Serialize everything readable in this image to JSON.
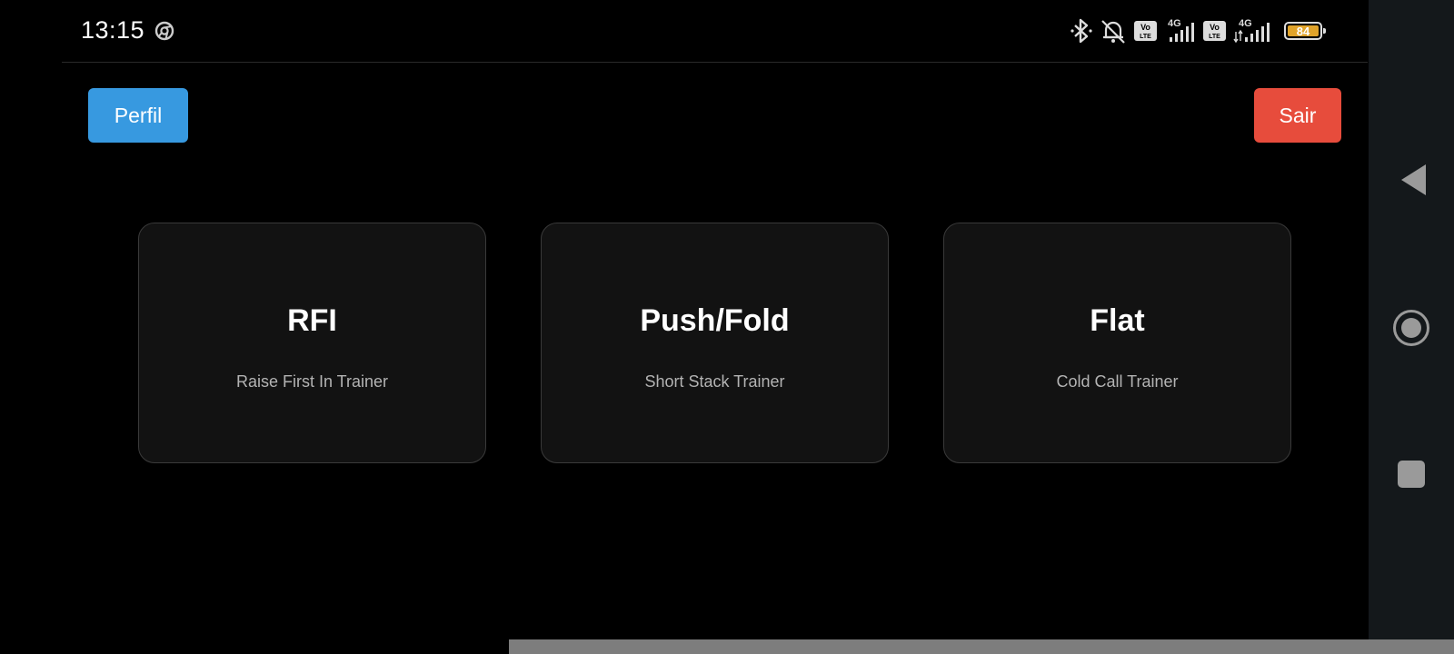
{
  "status_bar": {
    "time": "13:15",
    "battery_level": "84",
    "network_labels": [
      "4G",
      "4G"
    ],
    "volte_labels": [
      "Vo",
      "Vo"
    ],
    "icons": [
      "chrome-icon",
      "bluetooth-icon",
      "alarm-muted-icon",
      "volte-icon",
      "signal-icon",
      "volte-icon",
      "signal-icon",
      "battery-icon"
    ]
  },
  "header": {
    "profile_label": "Perfil",
    "exit_label": "Sair"
  },
  "cards": [
    {
      "title": "RFI",
      "subtitle": "Raise First In Trainer"
    },
    {
      "title": "Push/Fold",
      "subtitle": "Short Stack Trainer"
    },
    {
      "title": "Flat",
      "subtitle": "Cold Call Trainer"
    }
  ],
  "colors": {
    "profile_button": "#3799e0",
    "exit_button": "#e74c3c",
    "card_background": "#121212",
    "battery": "#e0a32a"
  },
  "nav_bar": {
    "icons": [
      "back-icon",
      "home-icon",
      "recents-icon"
    ]
  }
}
